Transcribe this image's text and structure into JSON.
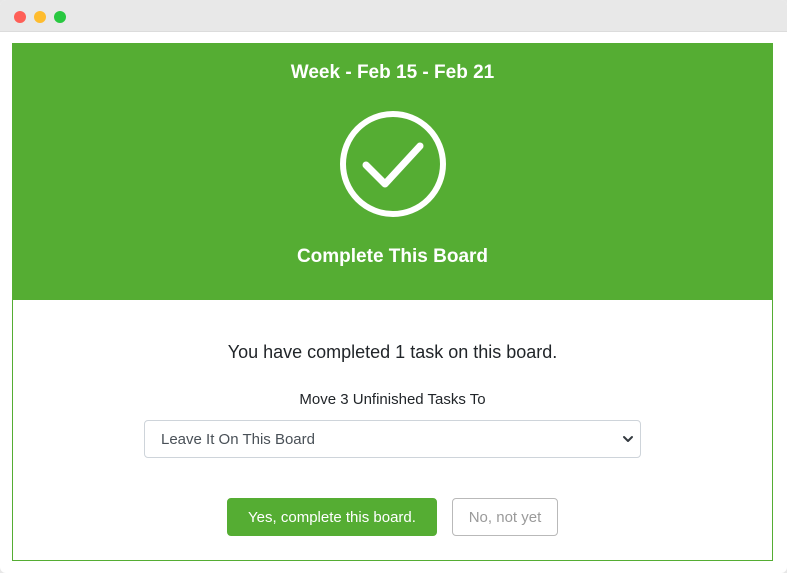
{
  "header": {
    "week_title": "Week - Feb 15 - Feb 21",
    "complete_title": "Complete This Board",
    "background_color": "#55ad33",
    "icon": "check-circle-icon"
  },
  "body": {
    "completed_text": "You have completed 1 task on this board.",
    "move_label": "Move 3 Unfinished Tasks To",
    "select": {
      "selected": "Leave It On This Board"
    }
  },
  "actions": {
    "confirm_label": "Yes, complete this board.",
    "cancel_label": "No, not yet"
  }
}
